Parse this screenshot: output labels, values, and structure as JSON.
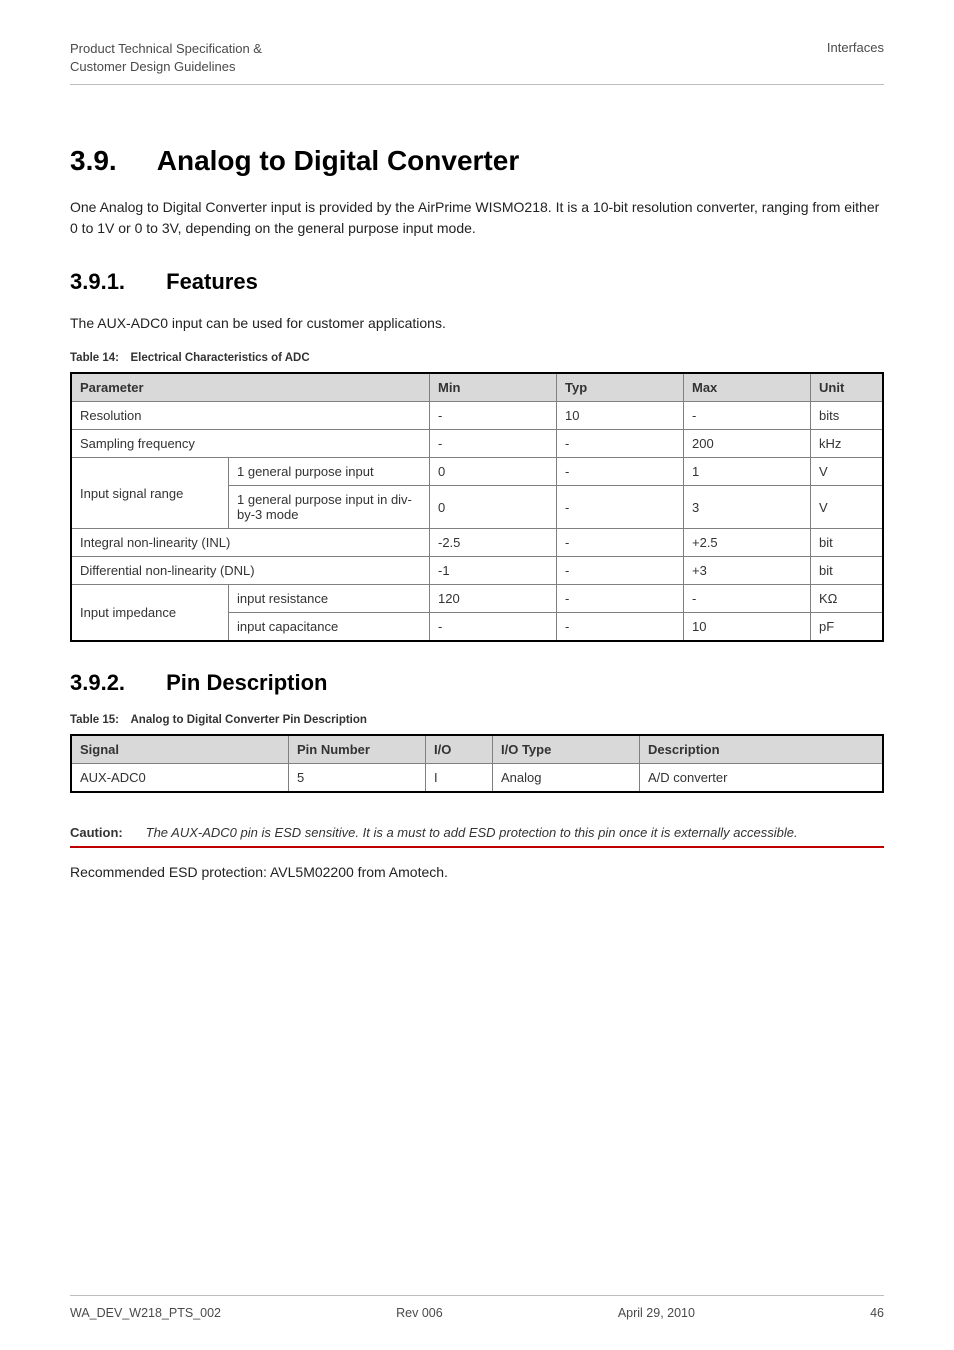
{
  "header": {
    "left_line1": "Product Technical Specification &",
    "left_line2": "Customer Design Guidelines",
    "right": "Interfaces"
  },
  "section": {
    "number": "3.9.",
    "title": "Analog to Digital Converter",
    "paragraph": "One Analog to Digital Converter input is provided by the AirPrime WISMO218. It is a 10-bit resolution converter, ranging from either 0 to 1V or 0 to 3V, depending on the general purpose input mode."
  },
  "sub391": {
    "number": "3.9.1.",
    "title": "Features",
    "intro": "The AUX-ADC0 input can be used for customer applications.",
    "table_caption": "Table 14: Electrical Characteristics of ADC"
  },
  "table14": {
    "headers": {
      "parameter": "Parameter",
      "min": "Min",
      "typ": "Typ",
      "max": "Max",
      "unit": "Unit"
    },
    "rows": {
      "resolution": {
        "param": "Resolution",
        "min": "-",
        "typ": "10",
        "max": "-",
        "unit": "bits"
      },
      "sampling": {
        "param": "Sampling frequency",
        "min": "-",
        "typ": "-",
        "max": "200",
        "unit": "kHz"
      },
      "isr_label": "Input signal range",
      "isr_r1": {
        "sub": "1 general purpose input",
        "min": "0",
        "typ": "-",
        "max": "1",
        "unit": "V"
      },
      "isr_r2": {
        "sub": "1 general purpose input in div-by-3 mode",
        "min": "0",
        "typ": "-",
        "max": "3",
        "unit": "V"
      },
      "inl": {
        "param": "Integral non-linearity (INL)",
        "min": "-2.5",
        "typ": "-",
        "max": "+2.5",
        "unit": "bit"
      },
      "dnl": {
        "param": "Differential non-linearity (DNL)",
        "min": "-1",
        "typ": "-",
        "max": "+3",
        "unit": "bit"
      },
      "imp_label": "Input impedance",
      "imp_r1": {
        "sub": "input resistance",
        "min": "120",
        "typ": "-",
        "max": "-",
        "unit": "KΩ"
      },
      "imp_r2": {
        "sub": "input capacitance",
        "min": "-",
        "typ": "-",
        "max": "10",
        "unit": "pF"
      }
    }
  },
  "sub392": {
    "number": "3.9.2.",
    "title": "Pin Description",
    "table_caption": "Table 15: Analog to Digital Converter Pin Description"
  },
  "table15": {
    "headers": {
      "signal": "Signal",
      "pin": "Pin Number",
      "io": "I/O",
      "iotype": "I/O Type",
      "desc": "Description"
    },
    "row": {
      "signal": "AUX-ADC0",
      "pin": "5",
      "io": "I",
      "iotype": "Analog",
      "desc": "A/D converter"
    }
  },
  "caution": {
    "label": "Caution:",
    "text": "The AUX-ADC0 pin is ESD sensitive. It is a must to add ESD protection to this pin once it is externally accessible."
  },
  "post_caution": "Recommended ESD protection: AVL5M02200 from Amotech.",
  "footer": {
    "left": "WA_DEV_W218_PTS_002",
    "center": "Rev 006",
    "right": "April 29, 2010",
    "page": "46"
  }
}
